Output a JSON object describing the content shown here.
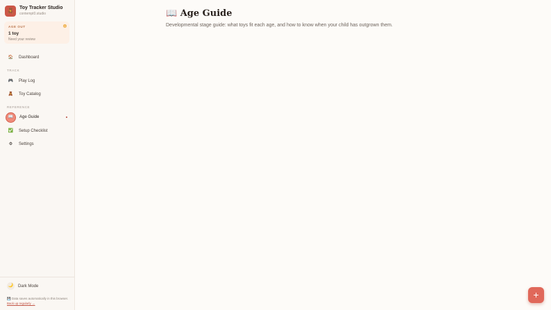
{
  "brand": {
    "logo_icon": "toy-icon",
    "name": "Toy Tracker Studio",
    "subtitle": "contempt0.studio"
  },
  "age_out_card": {
    "title": "AGE OUT",
    "badge": "0",
    "count": "1 toy",
    "note": "Need your review"
  },
  "nav": {
    "dashboard": {
      "label": "Dashboard",
      "icon": "🏠"
    },
    "track_section": "TRACK",
    "play_log": {
      "label": "Play Log",
      "icon": "🎮"
    },
    "toy_catalog": {
      "label": "Toy Catalog",
      "icon": "🧸"
    },
    "reference_section": "REFERENCE",
    "age_guide": {
      "label": "Age Guide",
      "icon": "📖"
    },
    "setup_checklist": {
      "label": "Setup Checklist",
      "icon": "✅"
    },
    "settings": {
      "label": "Settings",
      "icon": "⚙"
    }
  },
  "footer": {
    "dark_mode": {
      "label": "Dark Mode",
      "icon": "🌙"
    },
    "note_text": "💾 Data saves automatically in this browser.",
    "note_link": "Back up regularly →"
  },
  "main": {
    "title": "📖 Age Guide",
    "subtitle": "Developmental stage guide: what toys fit each age, and how to know when your child has outgrown them."
  },
  "fab": {
    "label": "+"
  },
  "colors": {
    "accent": "#e0685a",
    "sidebar_bg": "#faf7f3",
    "page_bg": "#fdfbf8",
    "card_bg": "#fdf0e6"
  }
}
